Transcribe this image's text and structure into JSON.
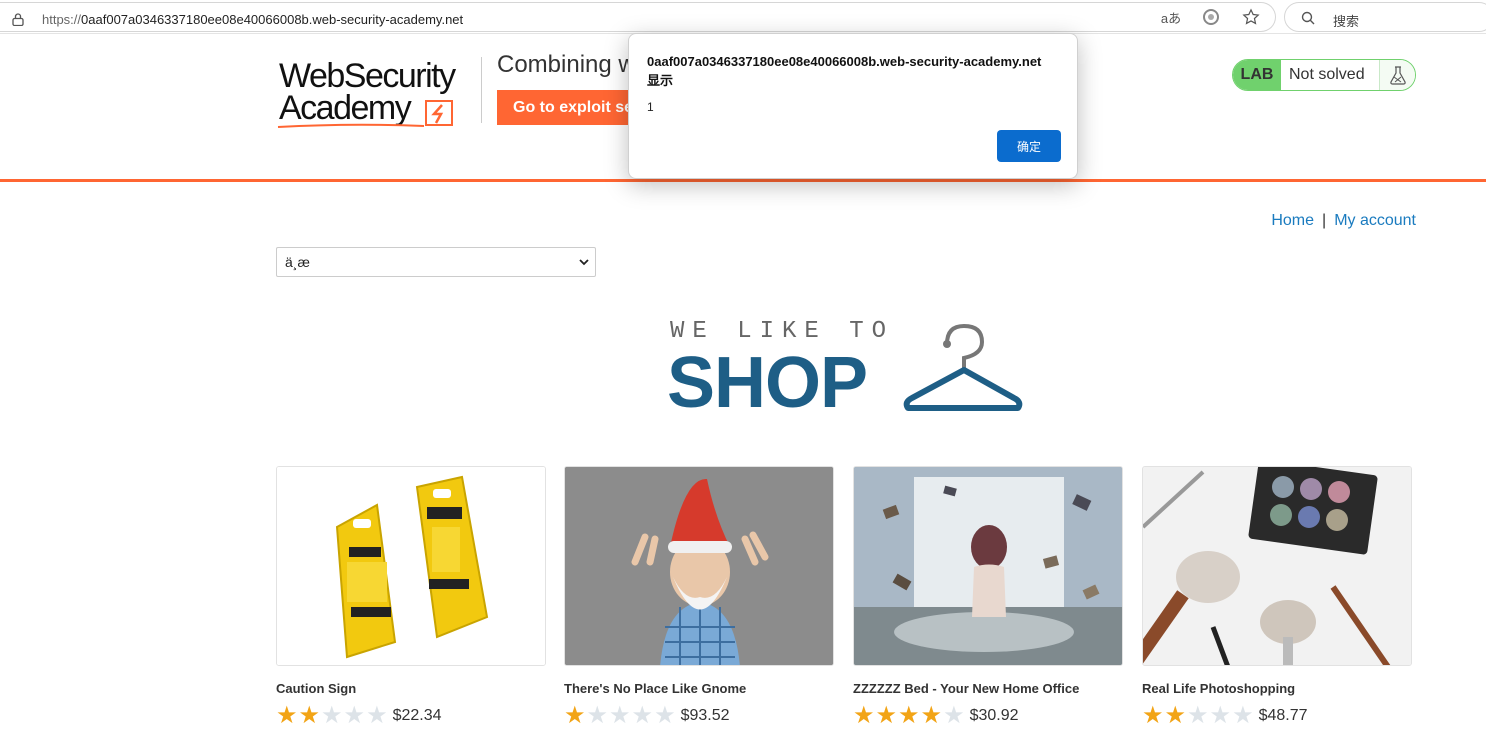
{
  "browser": {
    "url_proto": "https://",
    "url_host": "0aaf007a0346337180ee08e40066008b.web-security-academy.net",
    "search_placeholder": "搜索",
    "translate_label": "aあ"
  },
  "header": {
    "logo_line1": "WebSecurity",
    "logo_line2": "Academy",
    "lab_title": "Combining w",
    "exploit_button": "Go to exploit se",
    "lab_badge": "LAB",
    "lab_status": "Not solved"
  },
  "dialog": {
    "title": "0aaf007a0346337180ee08e40066008b.web-security-academy.net 显示",
    "message": "1",
    "ok_label": "确定"
  },
  "nav": {
    "home": "Home",
    "separator": "|",
    "account": "My account"
  },
  "language_select": {
    "value": "ä¸æ"
  },
  "banner": {
    "line1": "WE LIKE TO",
    "line2": "SHOP"
  },
  "products": [
    {
      "name": "Caution Sign",
      "price": "$22.34",
      "stars": 2
    },
    {
      "name": "There's No Place Like Gnome",
      "price": "$93.52",
      "stars": 1
    },
    {
      "name": "ZZZZZZ Bed - Your New Home Office",
      "price": "$30.92",
      "stars": 4
    },
    {
      "name": "Real Life Photoshopping",
      "price": "$48.77",
      "stars": 2
    }
  ],
  "colors": {
    "accent": "#ff6633",
    "link": "#1a7bbf",
    "lab_green": "#70d16d",
    "shop_blue": "#1e5e86",
    "star": "#f2a416",
    "dialog_button": "#0b6cce"
  }
}
